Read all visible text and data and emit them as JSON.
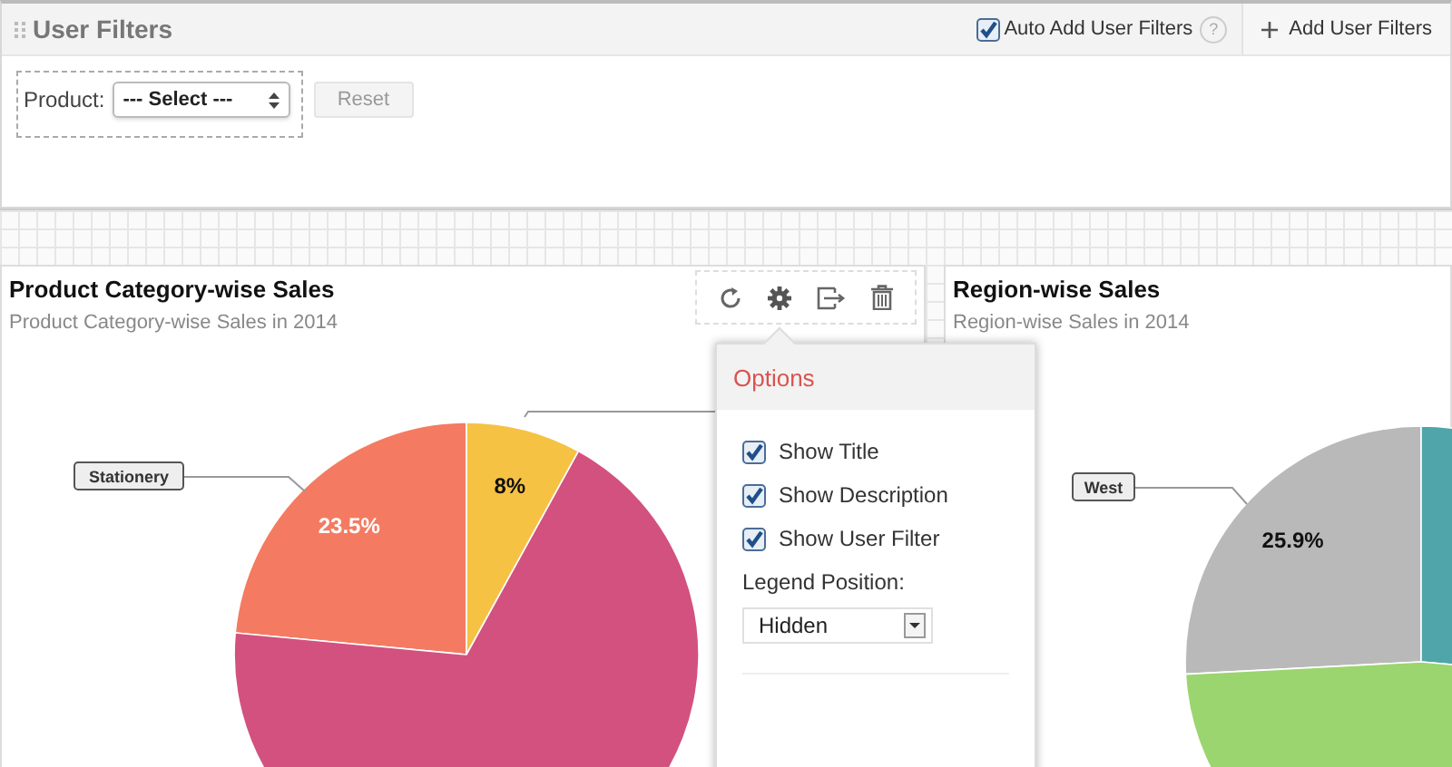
{
  "header": {
    "title": "User Filters",
    "auto_add": {
      "label": "Auto Add User Filters",
      "checked": true
    },
    "help": "?",
    "add_button": "Add User Filters"
  },
  "filters": [
    {
      "label": "Product:",
      "value": "--- Select ---"
    }
  ],
  "reset_button": "Reset",
  "charts": [
    {
      "title": "Product Category-wise Sales",
      "description": "Product Category-wise Sales in 2014",
      "slices": [
        {
          "color": "#f47b61",
          "label": "23.5%"
        },
        {
          "color": "#f6c244",
          "label": "8%"
        },
        {
          "color": "#d2517f"
        }
      ],
      "callouts": [
        "Stationery"
      ]
    },
    {
      "title": "Region-wise Sales",
      "description": "Region-wise Sales in 2014",
      "slices": [
        {
          "color": "#b9b9b9",
          "label": "25.9%"
        },
        {
          "color": "#4fa5aa"
        },
        {
          "color": "#9bd56f"
        }
      ],
      "callouts": [
        "West"
      ]
    }
  ],
  "options": {
    "title": "Options",
    "checkboxes": [
      {
        "label": "Show Title",
        "checked": true
      },
      {
        "label": "Show Description",
        "checked": true
      },
      {
        "label": "Show User Filter",
        "checked": true
      }
    ],
    "legend_label": "Legend Position:",
    "legend_value": "Hidden"
  }
}
